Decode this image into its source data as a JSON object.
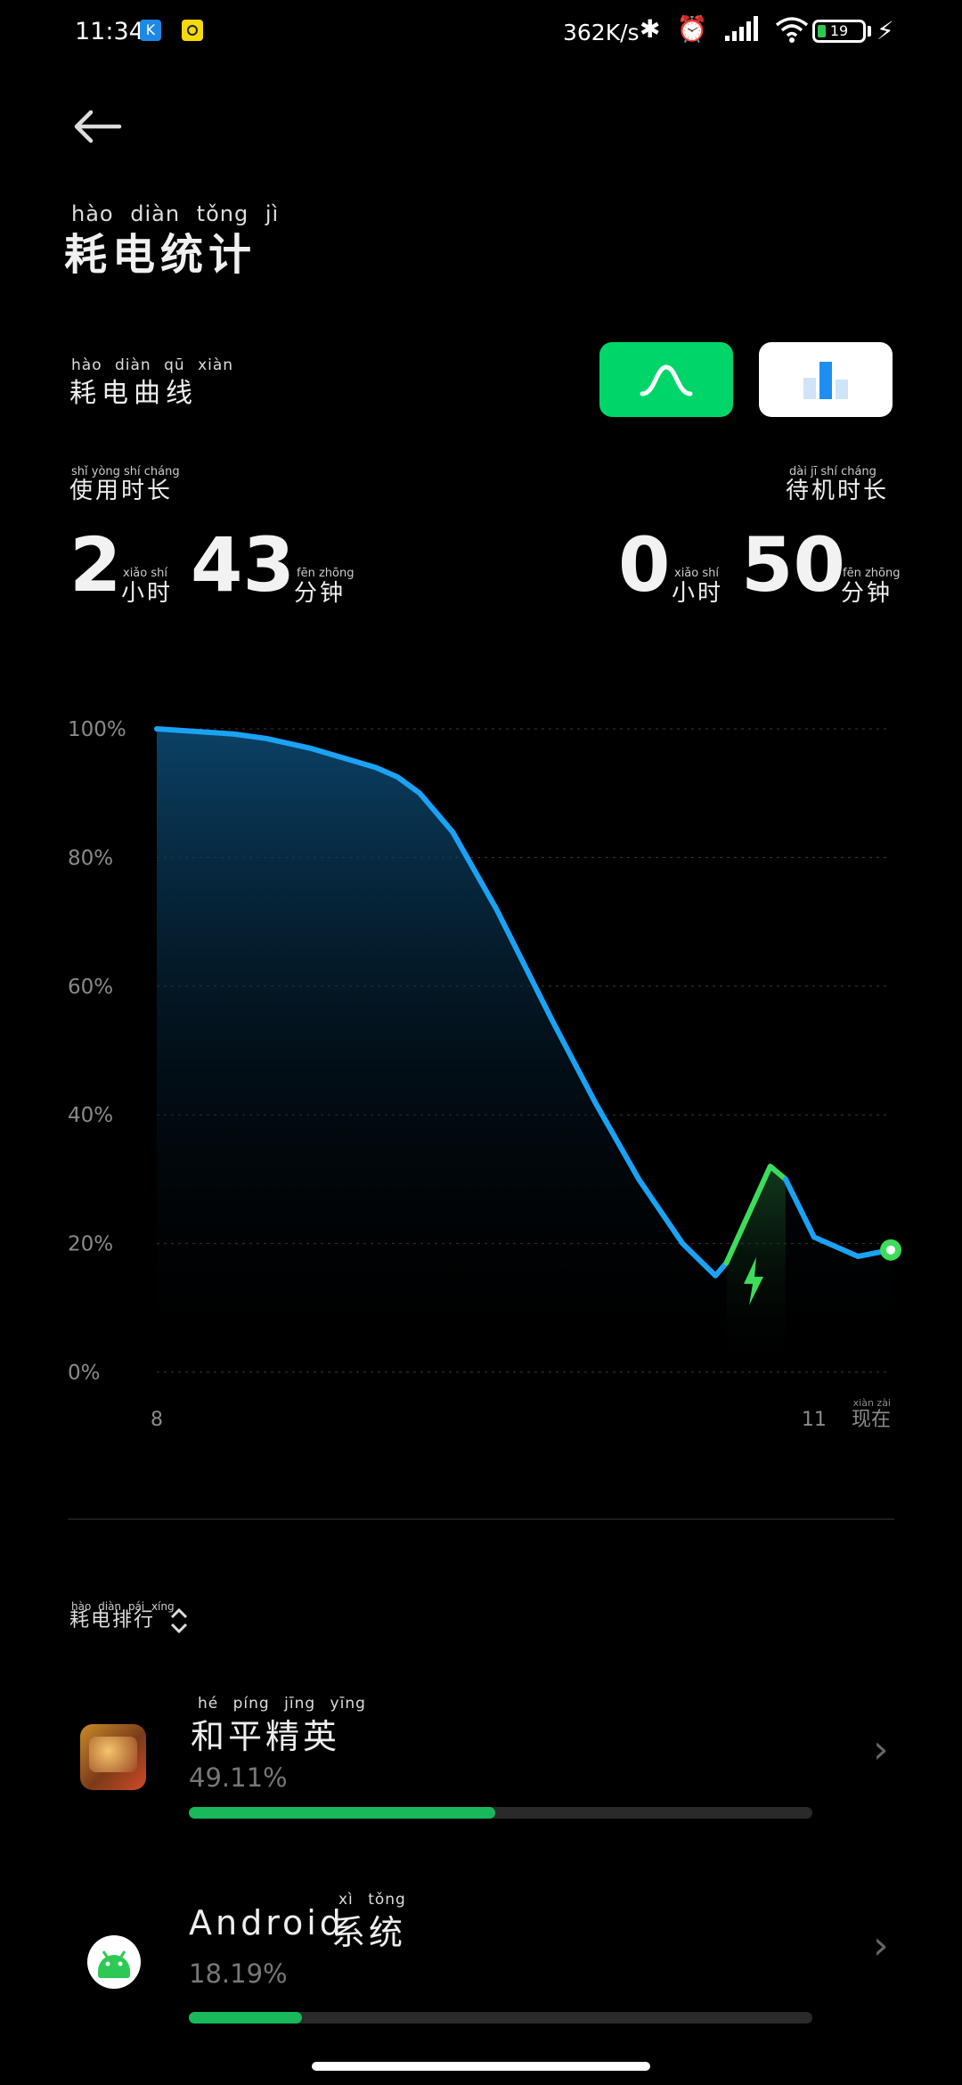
{
  "status_bar": {
    "time": "11:34",
    "notif_k": "K",
    "net_speed": "362K/s",
    "battery_level": "19",
    "battery_fraction": 0.19
  },
  "header": {
    "title": "耗电统计",
    "title_pinyin": "hào diàn tǒng jì"
  },
  "section": {
    "label": "耗电曲线",
    "label_pinyin": "hào diàn qū xiàn"
  },
  "usage": {
    "label": "使用时长",
    "label_pinyin": "shǐ yòng shí cháng",
    "hours": "2",
    "hours_unit": "小时",
    "hours_unit_pinyin": "xiǎo shí",
    "minutes": "43",
    "minutes_unit": "分钟",
    "minutes_unit_pinyin": "fēn zhōng"
  },
  "standby": {
    "label": "待机时长",
    "label_pinyin": "dài jī shí cháng",
    "hours": "0",
    "hours_unit": "小时",
    "hours_unit_pinyin": "xiǎo shí",
    "minutes": "50",
    "minutes_unit": "分钟",
    "minutes_unit_pinyin": "fēn zhōng"
  },
  "chart_data": {
    "type": "area",
    "y_ticks": [
      "100%",
      "80%",
      "60%",
      "40%",
      "20%",
      "0%"
    ],
    "x_ticks": [
      "8",
      "11",
      "现在"
    ],
    "x_now_pinyin": "xiàn zài",
    "ylim": [
      0,
      100
    ],
    "xlim": [
      8,
      11.35
    ],
    "grid": true,
    "series": [
      {
        "x": [
          8.0,
          8.35,
          8.5,
          8.7,
          8.85,
          9.0,
          9.1,
          9.2,
          9.35,
          9.55,
          9.8,
          10.0,
          10.2,
          10.4,
          10.55,
          10.6
        ],
        "values": [
          100,
          99.2,
          98.5,
          97,
          95.5,
          94,
          92.5,
          90,
          84,
          72,
          55,
          42,
          30,
          20,
          15,
          17
        ]
      },
      {
        "x": [
          10.6,
          10.8,
          10.87
        ],
        "values": [
          17,
          32,
          30
        ],
        "color": "#3ddc5a"
      },
      {
        "x": [
          10.87,
          11.0,
          11.2,
          11.35
        ],
        "values": [
          30,
          21,
          18,
          19
        ]
      }
    ],
    "line_color": "#1aa3f5",
    "charge_color": "#3ddc5a"
  },
  "ranking": {
    "label": "耗电排行",
    "label_pinyin": "hào diàn pái xíng",
    "apps": [
      {
        "name": "和平精英",
        "name_pinyin": "hé píng jīng yīng",
        "percent": "49.11%",
        "fraction": 0.4911
      },
      {
        "name_prefix": "Android",
        "name": "系统",
        "name_pinyin": "xì tǒng",
        "percent": "18.19%",
        "fraction": 0.1819
      }
    ]
  }
}
